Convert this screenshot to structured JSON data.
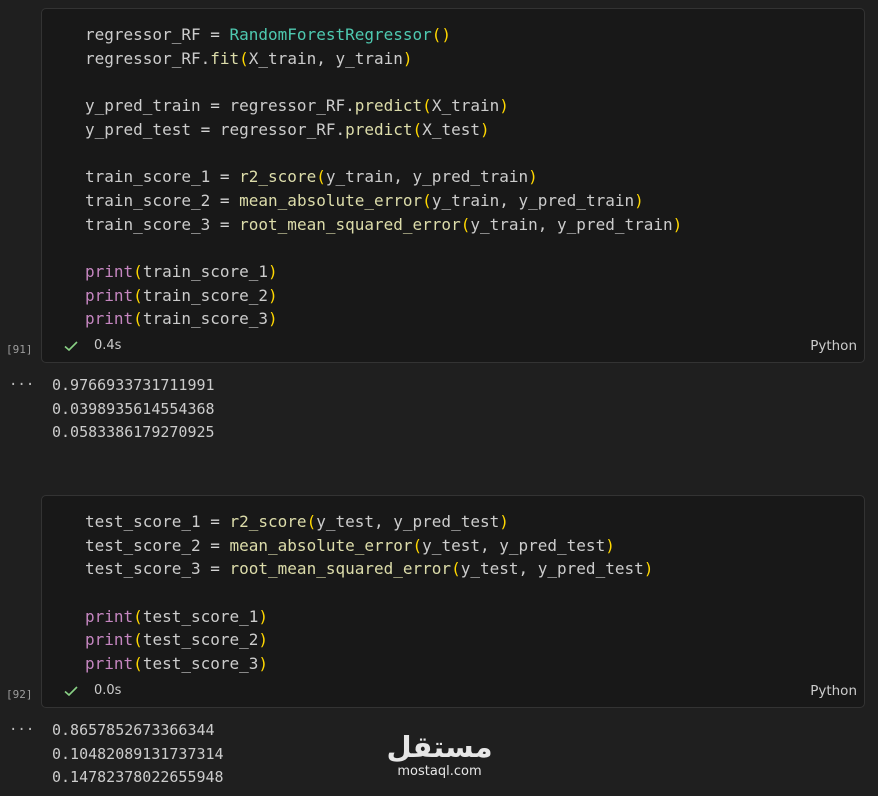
{
  "cells": [
    {
      "execution_count": "[91]",
      "exec_time": "0.4s",
      "language": "Python",
      "code": [
        [
          [
            "v",
            "regressor_RF"
          ],
          [
            "o",
            " = "
          ],
          [
            "c",
            "RandomForestRegressor"
          ],
          [
            "p",
            "()"
          ]
        ],
        [
          [
            "v",
            "regressor_RF."
          ],
          [
            "f",
            "fit"
          ],
          [
            "p",
            "("
          ],
          [
            "v",
            "X_train, y_train"
          ],
          [
            "p",
            ")"
          ]
        ],
        [],
        [
          [
            "v",
            "y_pred_train"
          ],
          [
            "o",
            " = "
          ],
          [
            "v",
            "regressor_RF."
          ],
          [
            "f",
            "predict"
          ],
          [
            "p",
            "("
          ],
          [
            "v",
            "X_train"
          ],
          [
            "p",
            ")"
          ]
        ],
        [
          [
            "v",
            "y_pred_test"
          ],
          [
            "o",
            " = "
          ],
          [
            "v",
            "regressor_RF."
          ],
          [
            "f",
            "predict"
          ],
          [
            "p",
            "("
          ],
          [
            "v",
            "X_test"
          ],
          [
            "p",
            ")"
          ]
        ],
        [],
        [
          [
            "v",
            "train_score_1"
          ],
          [
            "o",
            " = "
          ],
          [
            "f",
            "r2_score"
          ],
          [
            "p",
            "("
          ],
          [
            "v",
            "y_train, y_pred_train"
          ],
          [
            "p",
            ")"
          ]
        ],
        [
          [
            "v",
            "train_score_2"
          ],
          [
            "o",
            " = "
          ],
          [
            "f",
            "mean_absolute_error"
          ],
          [
            "p",
            "("
          ],
          [
            "v",
            "y_train, y_pred_train"
          ],
          [
            "p",
            ")"
          ]
        ],
        [
          [
            "v",
            "train_score_3"
          ],
          [
            "o",
            " = "
          ],
          [
            "f",
            "root_mean_squared_error"
          ],
          [
            "p",
            "("
          ],
          [
            "v",
            "y_train, y_pred_train"
          ],
          [
            "p",
            ")"
          ]
        ],
        [],
        [
          [
            "b",
            "print"
          ],
          [
            "p",
            "("
          ],
          [
            "v",
            "train_score_1"
          ],
          [
            "p",
            ")"
          ]
        ],
        [
          [
            "b",
            "print"
          ],
          [
            "p",
            "("
          ],
          [
            "v",
            "train_score_2"
          ],
          [
            "p",
            ")"
          ]
        ],
        [
          [
            "b",
            "print"
          ],
          [
            "p",
            "("
          ],
          [
            "v",
            "train_score_3"
          ],
          [
            "p",
            ")"
          ]
        ]
      ],
      "output_marker": "...",
      "output": [
        "0.9766933731711991",
        "0.0398935614554368",
        "0.0583386179270925"
      ]
    },
    {
      "execution_count": "[92]",
      "exec_time": "0.0s",
      "language": "Python",
      "code": [
        [
          [
            "v",
            "test_score_1"
          ],
          [
            "o",
            " = "
          ],
          [
            "f",
            "r2_score"
          ],
          [
            "p",
            "("
          ],
          [
            "v",
            "y_test, y_pred_test"
          ],
          [
            "p",
            ")"
          ]
        ],
        [
          [
            "v",
            "test_score_2"
          ],
          [
            "o",
            " = "
          ],
          [
            "f",
            "mean_absolute_error"
          ],
          [
            "p",
            "("
          ],
          [
            "v",
            "y_test, y_pred_test"
          ],
          [
            "p",
            ")"
          ]
        ],
        [
          [
            "v",
            "test_score_3"
          ],
          [
            "o",
            " = "
          ],
          [
            "f",
            "root_mean_squared_error"
          ],
          [
            "p",
            "("
          ],
          [
            "v",
            "y_test, y_pred_test"
          ],
          [
            "p",
            ")"
          ]
        ],
        [],
        [
          [
            "b",
            "print"
          ],
          [
            "p",
            "("
          ],
          [
            "v",
            "test_score_1"
          ],
          [
            "p",
            ")"
          ]
        ],
        [
          [
            "b",
            "print"
          ],
          [
            "p",
            "("
          ],
          [
            "v",
            "test_score_2"
          ],
          [
            "p",
            ")"
          ]
        ],
        [
          [
            "b",
            "print"
          ],
          [
            "p",
            "("
          ],
          [
            "v",
            "test_score_3"
          ],
          [
            "p",
            ")"
          ]
        ]
      ],
      "output_marker": "...",
      "output": [
        "0.8657852673366344",
        "0.10482089131737314",
        "0.14782378022655948"
      ]
    }
  ],
  "watermark": {
    "arabic": "مستقل",
    "latin": "mostaql.com"
  },
  "icons": {
    "status_check": "check-icon"
  },
  "colors": {
    "background": "#1f1f1f",
    "cell_background": "#181818",
    "success_check": "#89d185",
    "class_name": "#4ec9b0",
    "function": "#dcdcaa",
    "builtin": "#c586c0",
    "bracket": "#ffd700"
  }
}
